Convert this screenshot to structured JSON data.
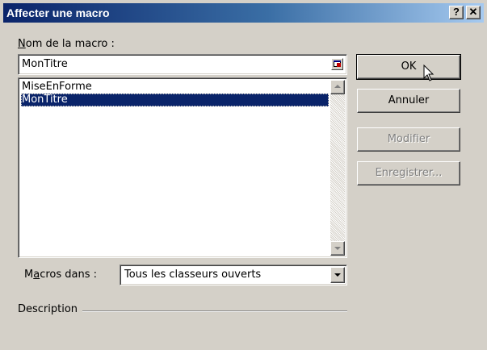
{
  "window": {
    "title": "Affecter une macro",
    "help_label": "?",
    "close_label": "✕"
  },
  "macro_name": {
    "label_underlined": "N",
    "label_rest": "om de la macro :",
    "value": "MonTitre"
  },
  "macro_list": {
    "items": [
      {
        "label": "MiseEnForme",
        "selected": false
      },
      {
        "label": "MonTitre",
        "selected": true
      }
    ]
  },
  "macros_in": {
    "label_pre": "M",
    "label_underlined": "a",
    "label_post": "cros dans :",
    "value": "Tous les classeurs ouverts"
  },
  "description": {
    "label": "Description"
  },
  "buttons": {
    "ok": "OK",
    "cancel": "Annuler",
    "modify": "Modifier",
    "save": "Enregistrer..."
  },
  "colors": {
    "face": "#d4d0c8",
    "title_start": "#0a246a",
    "title_end": "#a6caf0",
    "selection": "#0a246a"
  },
  "icons": [
    "help-icon",
    "close-icon",
    "collapse-dialog-icon",
    "scroll-up-icon",
    "scroll-down-icon",
    "dropdown-arrow-icon",
    "mouse-cursor-icon"
  ]
}
